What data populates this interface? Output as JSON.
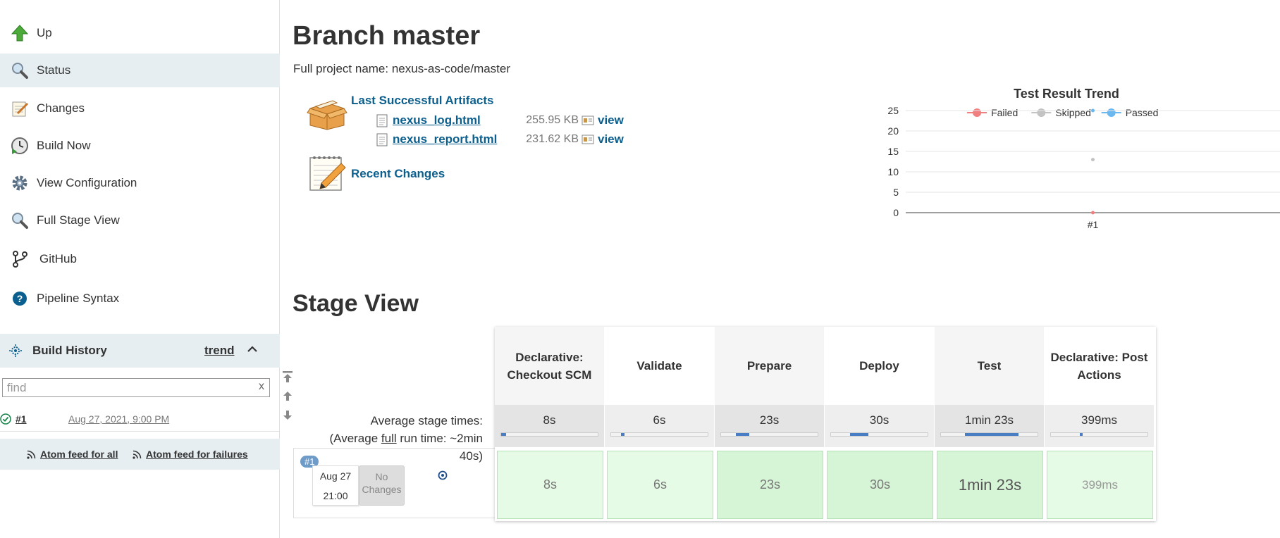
{
  "sidebar": {
    "tasks": [
      {
        "label": "Up",
        "icon": "up-arrow-icon"
      },
      {
        "label": "Status",
        "icon": "magnifier-icon"
      },
      {
        "label": "Changes",
        "icon": "notepad-icon"
      },
      {
        "label": "Build Now",
        "icon": "clock-play-icon"
      },
      {
        "label": "View Configuration",
        "icon": "gear-icon"
      },
      {
        "label": "Full Stage View",
        "icon": "magnifier-icon"
      },
      {
        "label": "GitHub",
        "icon": "branch-icon"
      },
      {
        "label": "Pipeline Syntax",
        "icon": "help-icon"
      }
    ],
    "build_history": {
      "title": "Build History",
      "trend_label": "trend",
      "find_placeholder": "find",
      "clear_label": "x",
      "builds": [
        {
          "number": "#1",
          "date": "Aug 27, 2021, 9:00 PM",
          "status": "success"
        }
      ]
    },
    "feeds": {
      "all": "Atom feed for all",
      "failures": "Atom feed for failures"
    }
  },
  "main": {
    "title": "Branch master",
    "full_project_name": "Full project name: nexus-as-code/master",
    "artifacts": {
      "label": "Last Successful Artifacts",
      "files": [
        {
          "name": "nexus_log.html",
          "size": "255.95 KB",
          "view": "view"
        },
        {
          "name": "nexus_report.html",
          "size": "231.62 KB",
          "view": "view"
        }
      ]
    },
    "recent_changes": "Recent Changes"
  },
  "chart_data": {
    "type": "line",
    "title": "Test Result Trend",
    "categories": [
      "#1"
    ],
    "series": [
      {
        "name": "Failed",
        "values": [
          0
        ],
        "color": "#f08080"
      },
      {
        "name": "Skipped",
        "values": [
          13
        ],
        "color": "#c3c3c3"
      },
      {
        "name": "Passed",
        "values": [
          25
        ],
        "color": "#6bb7f0"
      }
    ],
    "ylim": [
      0,
      25
    ],
    "yticks": [
      0,
      5,
      10,
      15,
      20,
      25
    ],
    "legend": "top",
    "grid": true
  },
  "stage_view": {
    "title": "Stage View",
    "avg_label_line1": "Average stage times:",
    "avg_label_line2_pre": "(Average ",
    "avg_label_line2_u": "full",
    "avg_label_line2_post": " run time: ~2min",
    "avg_label_line3": "40s)",
    "run": {
      "badge": "#1",
      "date": "Aug 27",
      "time": "21:00",
      "changes_line1": "No",
      "changes_line2": "Changes"
    },
    "stages": [
      {
        "name": "Declarative: Checkout SCM",
        "avg": "8s",
        "run": "8s",
        "avg_fraction": 0.05
      },
      {
        "name": "Validate",
        "avg": "6s",
        "run": "6s",
        "avg_fraction": 0.04
      },
      {
        "name": "Prepare",
        "avg": "23s",
        "run": "23s",
        "avg_fraction": 0.14
      },
      {
        "name": "Deploy",
        "avg": "30s",
        "run": "30s",
        "avg_fraction": 0.19
      },
      {
        "name": "Test",
        "avg": "1min 23s",
        "run": "1min 23s",
        "avg_fraction": 0.55
      },
      {
        "name": "Declarative: Post Actions",
        "avg": "399ms",
        "run": "399ms",
        "avg_fraction": 0.01
      }
    ]
  }
}
